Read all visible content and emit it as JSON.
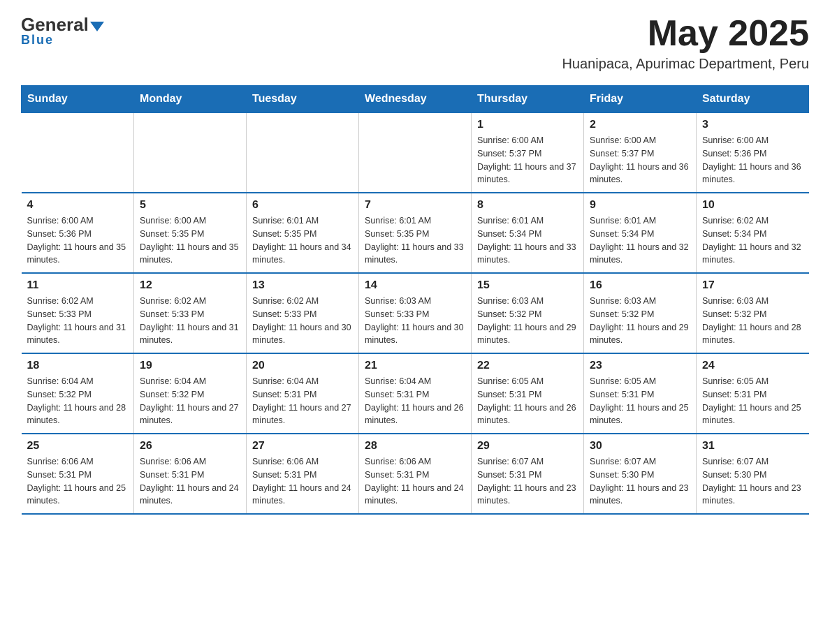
{
  "logo": {
    "general": "General",
    "triangle": "",
    "blue": "Blue"
  },
  "title": "May 2025",
  "subtitle": "Huanipaca, Apurimac Department, Peru",
  "days_of_week": [
    "Sunday",
    "Monday",
    "Tuesday",
    "Wednesday",
    "Thursday",
    "Friday",
    "Saturday"
  ],
  "weeks": [
    [
      {
        "day": "",
        "info": ""
      },
      {
        "day": "",
        "info": ""
      },
      {
        "day": "",
        "info": ""
      },
      {
        "day": "",
        "info": ""
      },
      {
        "day": "1",
        "info": "Sunrise: 6:00 AM\nSunset: 5:37 PM\nDaylight: 11 hours and 37 minutes."
      },
      {
        "day": "2",
        "info": "Sunrise: 6:00 AM\nSunset: 5:37 PM\nDaylight: 11 hours and 36 minutes."
      },
      {
        "day": "3",
        "info": "Sunrise: 6:00 AM\nSunset: 5:36 PM\nDaylight: 11 hours and 36 minutes."
      }
    ],
    [
      {
        "day": "4",
        "info": "Sunrise: 6:00 AM\nSunset: 5:36 PM\nDaylight: 11 hours and 35 minutes."
      },
      {
        "day": "5",
        "info": "Sunrise: 6:00 AM\nSunset: 5:35 PM\nDaylight: 11 hours and 35 minutes."
      },
      {
        "day": "6",
        "info": "Sunrise: 6:01 AM\nSunset: 5:35 PM\nDaylight: 11 hours and 34 minutes."
      },
      {
        "day": "7",
        "info": "Sunrise: 6:01 AM\nSunset: 5:35 PM\nDaylight: 11 hours and 33 minutes."
      },
      {
        "day": "8",
        "info": "Sunrise: 6:01 AM\nSunset: 5:34 PM\nDaylight: 11 hours and 33 minutes."
      },
      {
        "day": "9",
        "info": "Sunrise: 6:01 AM\nSunset: 5:34 PM\nDaylight: 11 hours and 32 minutes."
      },
      {
        "day": "10",
        "info": "Sunrise: 6:02 AM\nSunset: 5:34 PM\nDaylight: 11 hours and 32 minutes."
      }
    ],
    [
      {
        "day": "11",
        "info": "Sunrise: 6:02 AM\nSunset: 5:33 PM\nDaylight: 11 hours and 31 minutes."
      },
      {
        "day": "12",
        "info": "Sunrise: 6:02 AM\nSunset: 5:33 PM\nDaylight: 11 hours and 31 minutes."
      },
      {
        "day": "13",
        "info": "Sunrise: 6:02 AM\nSunset: 5:33 PM\nDaylight: 11 hours and 30 minutes."
      },
      {
        "day": "14",
        "info": "Sunrise: 6:03 AM\nSunset: 5:33 PM\nDaylight: 11 hours and 30 minutes."
      },
      {
        "day": "15",
        "info": "Sunrise: 6:03 AM\nSunset: 5:32 PM\nDaylight: 11 hours and 29 minutes."
      },
      {
        "day": "16",
        "info": "Sunrise: 6:03 AM\nSunset: 5:32 PM\nDaylight: 11 hours and 29 minutes."
      },
      {
        "day": "17",
        "info": "Sunrise: 6:03 AM\nSunset: 5:32 PM\nDaylight: 11 hours and 28 minutes."
      }
    ],
    [
      {
        "day": "18",
        "info": "Sunrise: 6:04 AM\nSunset: 5:32 PM\nDaylight: 11 hours and 28 minutes."
      },
      {
        "day": "19",
        "info": "Sunrise: 6:04 AM\nSunset: 5:32 PM\nDaylight: 11 hours and 27 minutes."
      },
      {
        "day": "20",
        "info": "Sunrise: 6:04 AM\nSunset: 5:31 PM\nDaylight: 11 hours and 27 minutes."
      },
      {
        "day": "21",
        "info": "Sunrise: 6:04 AM\nSunset: 5:31 PM\nDaylight: 11 hours and 26 minutes."
      },
      {
        "day": "22",
        "info": "Sunrise: 6:05 AM\nSunset: 5:31 PM\nDaylight: 11 hours and 26 minutes."
      },
      {
        "day": "23",
        "info": "Sunrise: 6:05 AM\nSunset: 5:31 PM\nDaylight: 11 hours and 25 minutes."
      },
      {
        "day": "24",
        "info": "Sunrise: 6:05 AM\nSunset: 5:31 PM\nDaylight: 11 hours and 25 minutes."
      }
    ],
    [
      {
        "day": "25",
        "info": "Sunrise: 6:06 AM\nSunset: 5:31 PM\nDaylight: 11 hours and 25 minutes."
      },
      {
        "day": "26",
        "info": "Sunrise: 6:06 AM\nSunset: 5:31 PM\nDaylight: 11 hours and 24 minutes."
      },
      {
        "day": "27",
        "info": "Sunrise: 6:06 AM\nSunset: 5:31 PM\nDaylight: 11 hours and 24 minutes."
      },
      {
        "day": "28",
        "info": "Sunrise: 6:06 AM\nSunset: 5:31 PM\nDaylight: 11 hours and 24 minutes."
      },
      {
        "day": "29",
        "info": "Sunrise: 6:07 AM\nSunset: 5:31 PM\nDaylight: 11 hours and 23 minutes."
      },
      {
        "day": "30",
        "info": "Sunrise: 6:07 AM\nSunset: 5:30 PM\nDaylight: 11 hours and 23 minutes."
      },
      {
        "day": "31",
        "info": "Sunrise: 6:07 AM\nSunset: 5:30 PM\nDaylight: 11 hours and 23 minutes."
      }
    ]
  ]
}
